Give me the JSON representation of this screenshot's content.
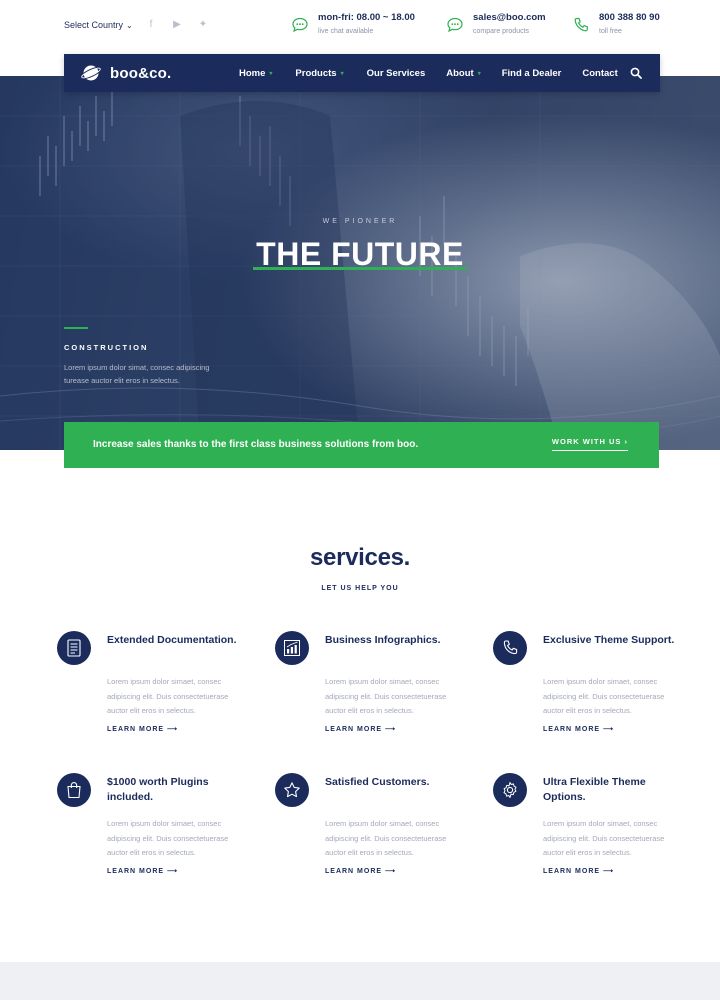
{
  "topbar": {
    "country_label": "Select Country",
    "country_chevron": "⌄",
    "socials": [
      {
        "icon": "facebook-icon",
        "glyph": "f"
      },
      {
        "icon": "youtube-icon",
        "glyph": "▶"
      },
      {
        "icon": "twitter-icon",
        "glyph": "✦"
      }
    ],
    "contacts": [
      {
        "icon": "chat-icon",
        "main": "mon-fri: 08.00 ~ 18.00",
        "sub": "live chat available"
      },
      {
        "icon": "chat-icon",
        "main": "sales@boo.com",
        "sub": "compare products"
      },
      {
        "icon": "phone-icon",
        "main": "800 388 80 90",
        "sub": "toll free"
      }
    ]
  },
  "nav": {
    "logo_text": "boo&co.",
    "items": [
      {
        "label": "Home",
        "has_dropdown": true
      },
      {
        "label": "Products",
        "has_dropdown": true
      },
      {
        "label": "Our Services",
        "has_dropdown": false
      },
      {
        "label": "About",
        "has_dropdown": true
      },
      {
        "label": "Find a Dealer",
        "has_dropdown": false
      },
      {
        "label": "Contact",
        "has_dropdown": false
      }
    ],
    "dropdown_glyph": "▾"
  },
  "hero": {
    "pretitle": "WE PIONEER",
    "title": "THE FUTURE",
    "category": "CONSTRUCTION",
    "description": "Lorem ipsum dolor simat, consec adipiscing turease auctor elit eros in selectus."
  },
  "banner": {
    "text": "Increase sales thanks to the first class business solutions from boo.",
    "button": "WORK WITH US  ›"
  },
  "services": {
    "title": "services.",
    "subtitle": "LET US HELP YOU",
    "items": [
      {
        "icon": "document-icon",
        "title": "Extended Documentation.",
        "desc": "Lorem ipsum dolor simaet, consec adipiscing elit. Duis consectetuerase auctor elit eros in selectus.",
        "link": "LEARN MORE ⟶"
      },
      {
        "icon": "bar-chart-icon",
        "title": "Business Infographics.",
        "desc": "Lorem ipsum dolor simaet, consec adipiscing elit. Duis consectetuerase auctor elit eros in selectus.",
        "link": "LEARN MORE ⟶"
      },
      {
        "icon": "phone-icon",
        "title": "Exclusive Theme Support.",
        "desc": "Lorem ipsum dolor simaet, consec adipiscing elit. Duis consectetuerase auctor elit eros in selectus.",
        "link": "LEARN MORE ⟶"
      },
      {
        "icon": "shopping-bag-icon",
        "title": "$1000 worth Plugins included.",
        "desc": "Lorem ipsum dolor simaet, consec adipiscing elit. Duis consectetuerase auctor elit eros in selectus.",
        "link": "LEARN MORE ⟶"
      },
      {
        "icon": "star-icon",
        "title": "Satisfied Customers.",
        "desc": "Lorem ipsum dolor simaet, consec adipiscing elit. Duis consectetuerase auctor elit eros in selectus.",
        "link": "LEARN MORE ⟶"
      },
      {
        "icon": "gear-icon",
        "title": "Ultra Flexible Theme Options.",
        "desc": "Lorem ipsum dolor simaet, consec adipiscing elit. Duis consectetuerase auctor elit eros in selectus.",
        "link": "LEARN MORE ⟶"
      }
    ]
  },
  "colors": {
    "navy": "#1a2b5c",
    "green": "#2fb052",
    "muted_text": "#a3a9b7",
    "footer_band": "#eff0f3"
  }
}
